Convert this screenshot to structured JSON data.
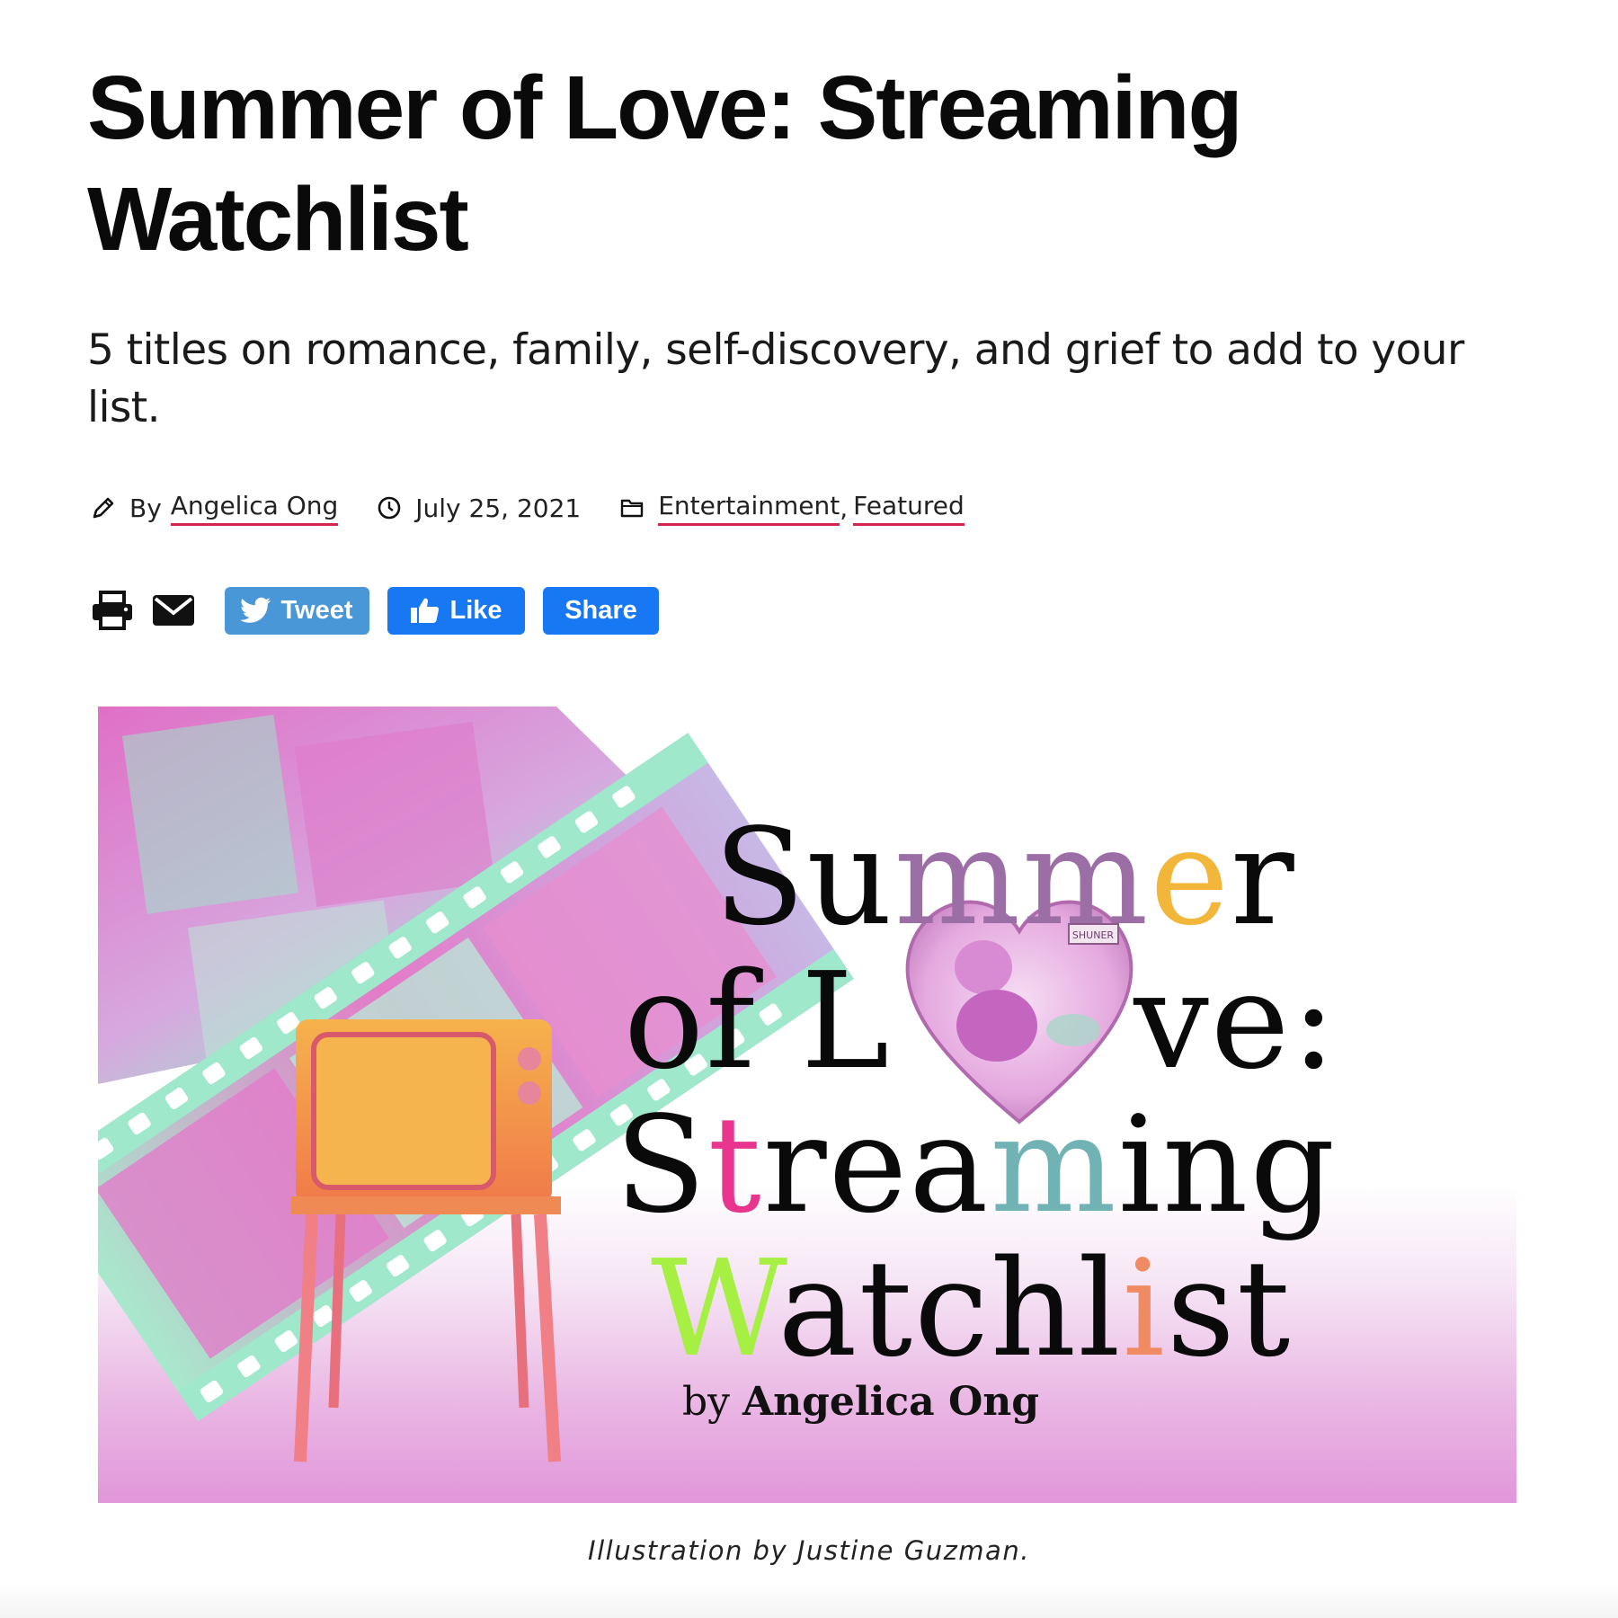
{
  "article": {
    "title": "Summer of Love: Streaming Watchlist",
    "subtitle": "5 titles on romance, family, self-discovery, and grief to add to your list."
  },
  "meta": {
    "by_prefix": "By",
    "author": "Angelica Ong",
    "date": "July 25, 2021",
    "categories": [
      "Entertainment",
      "Featured"
    ],
    "category_separator": ",",
    "icons": [
      "pencil-icon",
      "clock-icon",
      "folder-icon"
    ]
  },
  "share": {
    "tools": [
      "print-icon",
      "email-icon"
    ],
    "tweet_label": "Tweet",
    "like_label": "Like",
    "share_label": "Share",
    "colors": {
      "twitter": "#4a97d8",
      "facebook": "#1877f2",
      "link_underline": "#d4234f"
    }
  },
  "hero": {
    "title_lines": {
      "l1": [
        "Su",
        "mm",
        "e",
        "r"
      ],
      "l2": [
        "of L",
        "ve:"
      ],
      "l3": [
        "S",
        "t",
        "rea",
        "m",
        "ing"
      ],
      "l4": [
        "W",
        "atchl",
        "i",
        "st"
      ]
    },
    "byline_prefix": "by",
    "byline_name": "Angelica Ong",
    "heart_label": "SHUNER",
    "accent_colors": [
      "#9b6fa6",
      "#f2b63a",
      "#e8368f",
      "#71b3b5",
      "#a6f043",
      "#f08a62",
      "#e196da"
    ]
  },
  "caption": "Illustration by Justine Guzman."
}
